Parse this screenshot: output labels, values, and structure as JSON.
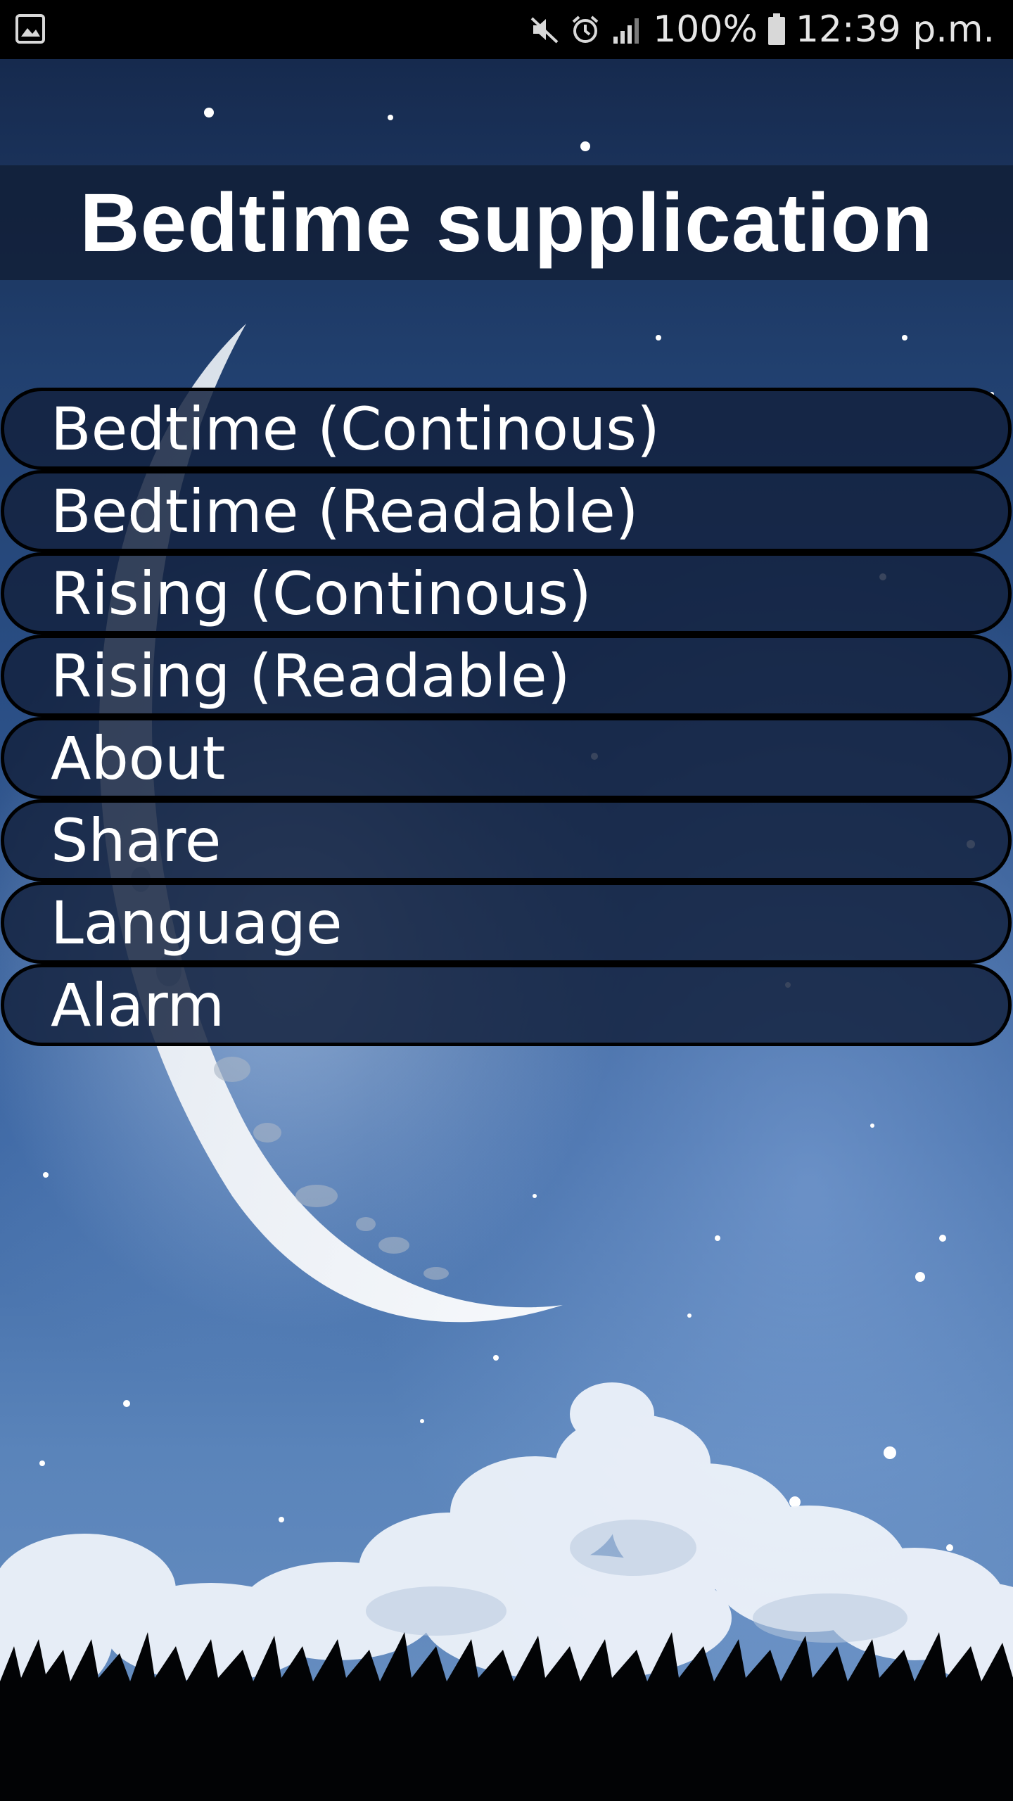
{
  "status_bar": {
    "battery_percent": "100%",
    "time": "12:39 p.m.",
    "icons": [
      "image-notification-icon",
      "mute-icon",
      "alarm-icon",
      "signal-icon",
      "battery-icon"
    ]
  },
  "app": {
    "title": "Bedtime supplication"
  },
  "menu": {
    "items": [
      {
        "label": "Bedtime (Continous)"
      },
      {
        "label": "Bedtime (Readable)"
      },
      {
        "label": "Rising (Continous)"
      },
      {
        "label": "Rising (Readable)"
      },
      {
        "label": "About"
      },
      {
        "label": "Share"
      },
      {
        "label": "Language"
      },
      {
        "label": "Alarm"
      }
    ]
  },
  "colors": {
    "status_bar": "#000000",
    "banner": "#121f38",
    "menu_item": "#13213e",
    "text": "#ffffff"
  }
}
